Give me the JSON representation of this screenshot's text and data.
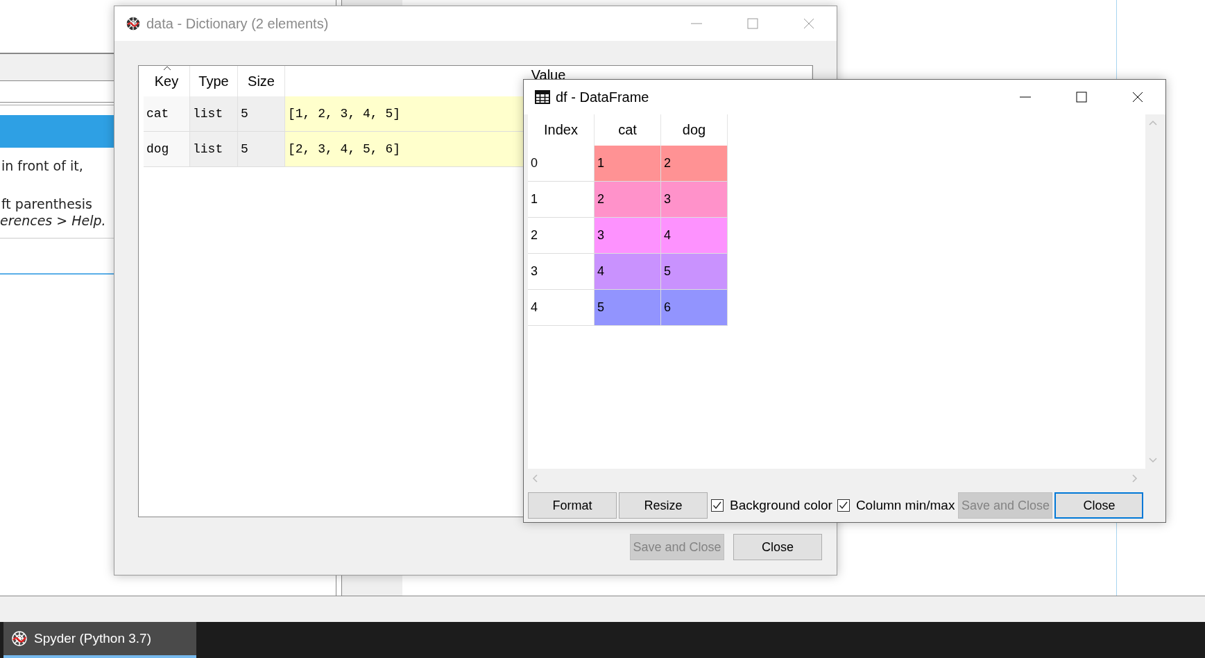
{
  "background": {
    "help_lines": [
      {
        "text": "in front of it,",
        "italic": false
      },
      {
        "text": "ft parenthesis",
        "italic": false
      },
      {
        "text": "erences > Help.",
        "italic": true
      }
    ]
  },
  "dict_window": {
    "title": "data - Dictionary (2 elements)",
    "active": false,
    "columns": [
      {
        "label": "Key",
        "sorted": true
      },
      {
        "label": "Type",
        "sorted": false
      },
      {
        "label": "Size",
        "sorted": false
      },
      {
        "label": "Value",
        "sorted": false
      }
    ],
    "rows": [
      {
        "key": "cat",
        "type": "list",
        "size": "5",
        "value": "[1, 2, 3, 4, 5]"
      },
      {
        "key": "dog",
        "type": "list",
        "size": "5",
        "value": "[2, 3, 4, 5, 6]"
      }
    ],
    "buttons": [
      {
        "label": "Save and Close",
        "disabled": true
      },
      {
        "label": "Close",
        "disabled": false
      }
    ]
  },
  "df_window": {
    "title": "df - DataFrame",
    "active": true,
    "columns": [
      "Index",
      "cat",
      "dog"
    ],
    "rows": [
      {
        "index": "0",
        "cells": [
          "1",
          "2"
        ],
        "color": "#ff9294"
      },
      {
        "index": "1",
        "cells": [
          "2",
          "3"
        ],
        "color": "#ff92ca"
      },
      {
        "index": "2",
        "cells": [
          "3",
          "4"
        ],
        "color": "#fd92fe"
      },
      {
        "index": "3",
        "cells": [
          "4",
          "5"
        ],
        "color": "#c992fe"
      },
      {
        "index": "4",
        "cells": [
          "5",
          "6"
        ],
        "color": "#9294fe"
      }
    ],
    "tools": [
      {
        "label": "Format"
      },
      {
        "label": "Resize"
      }
    ],
    "checkboxes": [
      {
        "label": "Background color",
        "checked": true
      },
      {
        "label": "Column min/max",
        "checked": true
      }
    ],
    "buttons": [
      {
        "label": "Save and Close",
        "disabled": true,
        "default": false
      },
      {
        "label": "Close",
        "disabled": false,
        "default": true
      }
    ]
  },
  "taskbar": {
    "items": [
      {
        "label": "Spyder (Python 3.7)",
        "selected": true
      }
    ]
  }
}
